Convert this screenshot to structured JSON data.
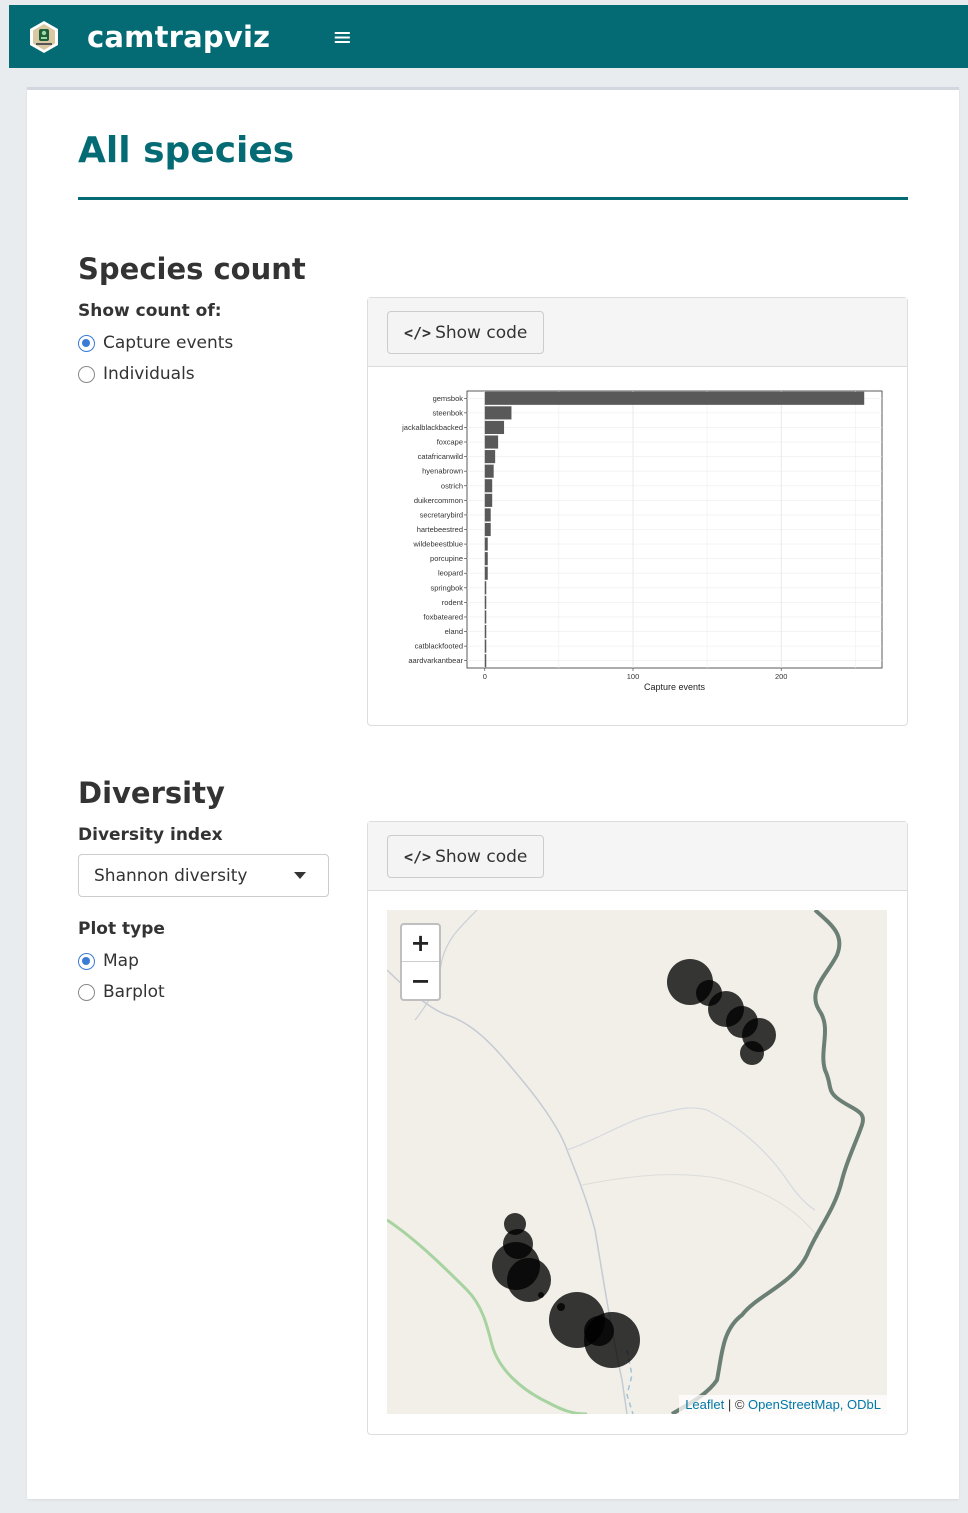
{
  "app": {
    "name": "camtrapviz",
    "menu_icon": "hamburger-icon",
    "logo_icon": "camera-trap-hex-logo"
  },
  "page": {
    "title": "All species"
  },
  "colors": {
    "brand": "#046b74",
    "radio_active": "#3a7bd5",
    "bar": "#595959",
    "map_bg": "#f2efe9",
    "river": "#6b7f75",
    "marker": "#000000"
  },
  "species_count": {
    "heading": "Species count",
    "control_label": "Show count of:",
    "options": [
      "Capture events",
      "Individuals"
    ],
    "selected": "Capture events",
    "code_button": "Show code"
  },
  "chart_data": {
    "type": "bar",
    "orientation": "horizontal",
    "categories": [
      "gemsbok",
      "steenbok",
      "jackalblackbacked",
      "foxcape",
      "catafricanwild",
      "hyenabrown",
      "ostrich",
      "duikercommon",
      "secretarybird",
      "hartebeestred",
      "wildebeestblue",
      "porcupine",
      "leopard",
      "springbok",
      "rodent",
      "foxbateared",
      "eland",
      "catblackfooted",
      "aardvarkantbear"
    ],
    "values": [
      256,
      18,
      13,
      9,
      7,
      6,
      5,
      5,
      4,
      4,
      2,
      2,
      2,
      1,
      1,
      1,
      1,
      1,
      1
    ],
    "xlabel": "Capture events",
    "ylabel": "",
    "xlim": [
      -12,
      268
    ],
    "xticks": [
      0,
      100,
      200
    ],
    "grid": true
  },
  "diversity": {
    "heading": "Diversity",
    "index_label": "Diversity index",
    "index_value": "Shannon diversity",
    "plot_type_label": "Plot type",
    "plot_options": [
      "Map",
      "Barplot"
    ],
    "plot_selected": "Map",
    "code_button": "Show code"
  },
  "map": {
    "zoom_in": "+",
    "zoom_out": "−",
    "attribution": {
      "leaflet": "Leaflet",
      "sep": " | © ",
      "osm": "OpenStreetMap, ODbL"
    }
  }
}
